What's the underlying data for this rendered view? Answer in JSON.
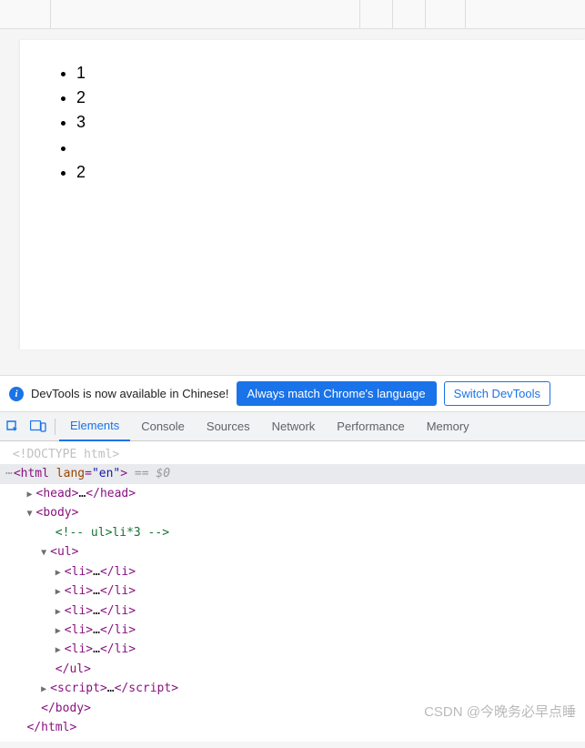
{
  "page": {
    "list_items": [
      "1",
      "2",
      "3",
      "",
      "2"
    ]
  },
  "infobar": {
    "message": "DevTools is now available in Chinese!",
    "btn_match": "Always match Chrome's language",
    "btn_switch": "Switch DevTools"
  },
  "tabs": {
    "elements": "Elements",
    "console": "Console",
    "sources": "Sources",
    "network": "Network",
    "performance": "Performance",
    "memory": "Memory"
  },
  "dom": {
    "doctype": "<!DOCTYPE html>",
    "html_open": "html",
    "lang_attr": "lang",
    "lang_val": "\"en\"",
    "sel_marker": "== $0",
    "head": "head",
    "body": "body",
    "comment": "<!-- ul>li*3 -->",
    "ul": "ul",
    "li": "li",
    "script": "script",
    "ellipsis": "…"
  },
  "watermark": "CSDN @今晚务必早点睡"
}
